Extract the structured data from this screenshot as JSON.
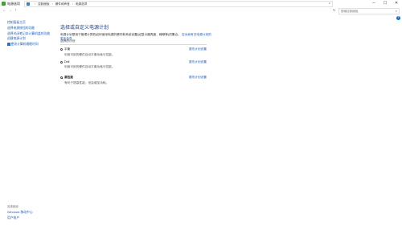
{
  "window": {
    "title": "电源选项",
    "controls": {
      "minimize": "─",
      "maximize": "☐",
      "close": "✕"
    }
  },
  "address": {
    "back": "←",
    "forward": "→",
    "up": "↑",
    "breadcrumbs": [
      "控制面板",
      "硬件和声音",
      "电源选项"
    ],
    "search_placeholder": "搜索控制面板",
    "refresh": "↻",
    "dropdown": "∨"
  },
  "help": "?",
  "sidebar": {
    "items": [
      "控制面板主页",
      "选择电源按钮的功能",
      "选择关闭笔记本计算机盖的功能",
      "创建电源计划",
      "更改计算机睡眠时间"
    ],
    "see_also": "另请参阅",
    "bottom_links": [
      "Windows 移动中心",
      "用户帐户"
    ]
  },
  "main": {
    "title": "选择或自定义电源计划",
    "description": "电源计划是用于管理计算机如何使用电源的硬件和系统设置(如显示器亮度、睡眠等)的集合。",
    "description_link": "告诉我有关电源计划的更多信息",
    "section_header": "选择的计划",
    "plans": [
      {
        "name": "平衡",
        "desc": "利用可用的硬件自动平衡功耗与性能。",
        "change": "更改计划设置",
        "selected": false
      },
      {
        "name": "Dell",
        "desc": "利用可用的硬件自动平衡功耗与性能。",
        "change": "更改计划设置",
        "selected": false
      },
      {
        "name": "高性能",
        "desc": "有利于提高性能，但会增加功耗。",
        "change": "更改计划设置",
        "selected": true
      }
    ]
  }
}
